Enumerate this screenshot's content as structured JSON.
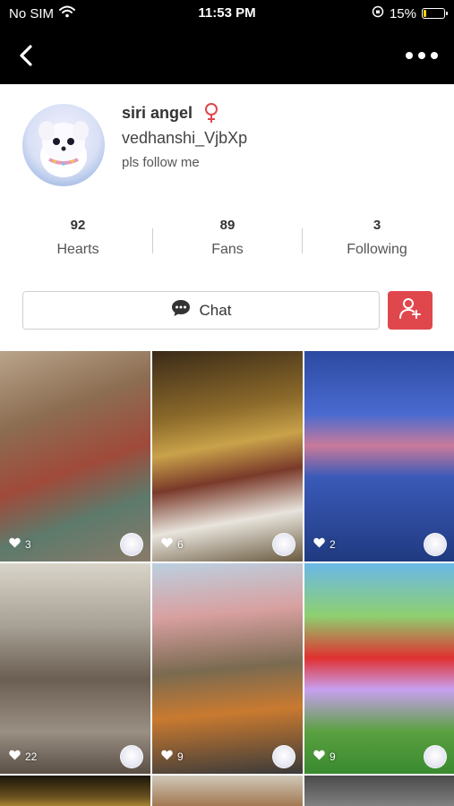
{
  "status_bar": {
    "carrier": "No SIM",
    "time": "11:53 PM",
    "battery": "15%",
    "battery_level": 0.15
  },
  "nav": {
    "back_icon": "chevron-left-icon",
    "more_icon": "more-horizontal-icon"
  },
  "profile": {
    "display_name": "siri angel",
    "gender_icon": "female-icon",
    "username": "vedhanshi_VjbXp",
    "bio": "pls follow me"
  },
  "stats": [
    {
      "value": "92",
      "label": "Hearts"
    },
    {
      "value": "89",
      "label": "Fans"
    },
    {
      "value": "3",
      "label": "Following"
    }
  ],
  "actions": {
    "chat_label": "Chat",
    "follow_icon": "add-user-icon"
  },
  "videos": [
    {
      "likes": "3"
    },
    {
      "likes": "6"
    },
    {
      "likes": "2"
    },
    {
      "likes": "22"
    },
    {
      "likes": "9"
    },
    {
      "likes": "9"
    },
    {
      "likes": ""
    },
    {
      "likes": ""
    },
    {
      "likes": ""
    }
  ],
  "colors": {
    "top_bar": "#000000",
    "follow_button": "#e0474d",
    "gender_icon": "#e0474d"
  }
}
